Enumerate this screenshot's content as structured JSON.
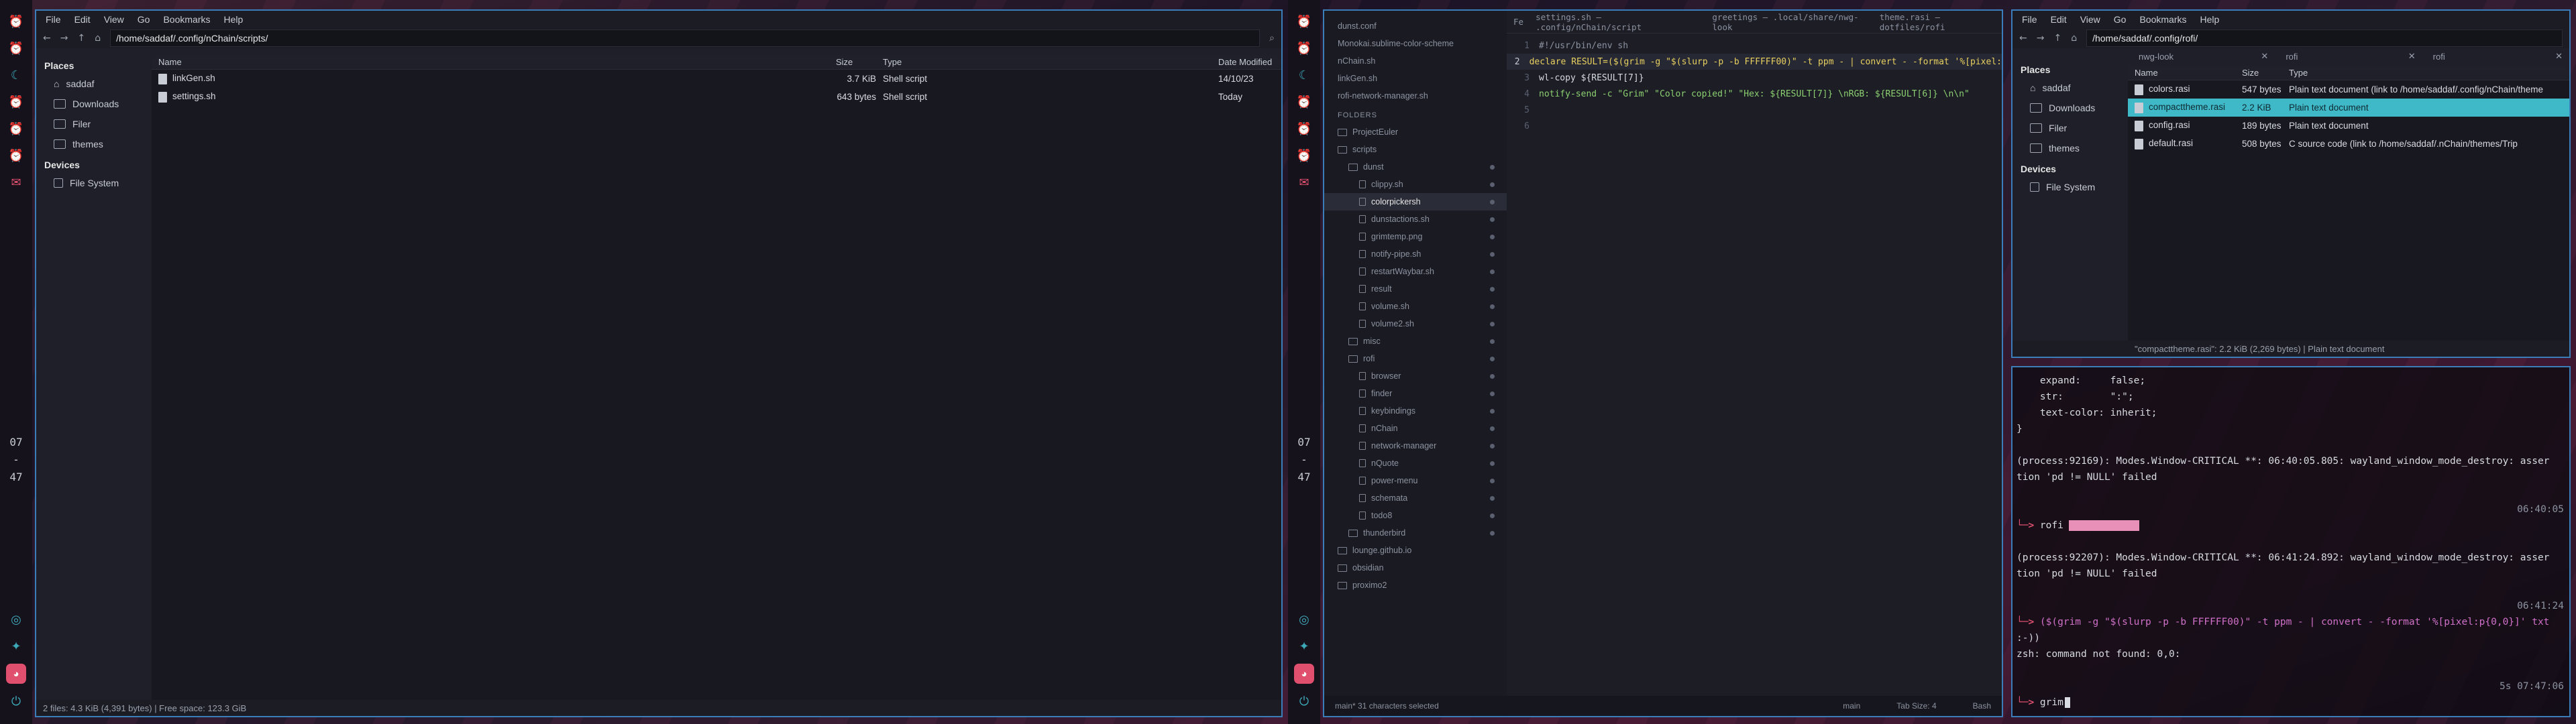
{
  "colors": {
    "accent": "#3fb8c8",
    "alert": "#e0506e",
    "border": "#3a7db8"
  },
  "bars": [
    {
      "icons": [
        "bell-icon",
        "bell-icon",
        "moon-icon",
        "bell-icon",
        "bell-icon",
        "bell-icon",
        "mail-icon"
      ],
      "clock": [
        "07",
        "-",
        "47"
      ],
      "bottom": [
        "network-icon",
        "share-icon",
        "discord-icon",
        "power-icon"
      ]
    }
  ],
  "left_fm": {
    "menu": [
      "File",
      "Edit",
      "View",
      "Go",
      "Bookmarks",
      "Help"
    ],
    "path": "/home/saddaf/.config/nChain/scripts/",
    "places_title": "Places",
    "places": [
      "saddaf",
      "Downloads",
      "Filer",
      "themes"
    ],
    "devices_title": "Devices",
    "devices": [
      "File System"
    ],
    "columns": [
      "Name",
      "Size",
      "Type",
      "Date Modified"
    ],
    "rows": [
      {
        "name": "linkGen.sh",
        "size": "3.7 KiB",
        "type": "Shell script",
        "date": "14/10/23"
      },
      {
        "name": "settings.sh",
        "size": "643 bytes",
        "type": "Shell script",
        "date": "Today"
      }
    ],
    "status": "2 files: 4.3 KiB (4,391 bytes) | Free space: 123.3 GiB"
  },
  "editor": {
    "open_files": [
      "dunst.conf",
      "Monokai.sublime-color-scheme",
      "nChain.sh",
      "linkGen.sh",
      "rofi-network-manager.sh"
    ],
    "tabs": [
      "Fe",
      "settings.sh — .config/nChain/script",
      "greetings — .local/share/nwg-look",
      "theme.rasi — dotfiles/rofi"
    ],
    "folders_label": "FOLDERS",
    "tree": [
      {
        "label": "ProjectEuler",
        "depth": 0,
        "folder": true
      },
      {
        "label": "scripts",
        "depth": 0,
        "folder": true
      },
      {
        "label": "dunst",
        "depth": 1,
        "folder": true
      },
      {
        "label": "clippy.sh",
        "depth": 2
      },
      {
        "label": "colorpickersh",
        "depth": 2,
        "active": true
      },
      {
        "label": "dunstactions.sh",
        "depth": 2
      },
      {
        "label": "grimtemp.png",
        "depth": 2
      },
      {
        "label": "notify-pipe.sh",
        "depth": 2
      },
      {
        "label": "restartWaybar.sh",
        "depth": 2
      },
      {
        "label": "result",
        "depth": 2
      },
      {
        "label": "volume.sh",
        "depth": 2
      },
      {
        "label": "volume2.sh",
        "depth": 2
      },
      {
        "label": "misc",
        "depth": 1,
        "folder": true
      },
      {
        "label": "rofi",
        "depth": 1,
        "folder": true
      },
      {
        "label": "browser",
        "depth": 2
      },
      {
        "label": "finder",
        "depth": 2
      },
      {
        "label": "keybindings",
        "depth": 2
      },
      {
        "label": "nChain",
        "depth": 2
      },
      {
        "label": "network-manager",
        "depth": 2
      },
      {
        "label": "nQuote",
        "depth": 2
      },
      {
        "label": "power-menu",
        "depth": 2
      },
      {
        "label": "schemata",
        "depth": 2
      },
      {
        "label": "todo8",
        "depth": 2
      },
      {
        "label": "thunderbird",
        "depth": 1,
        "folder": true
      },
      {
        "label": "lounge.github.io",
        "depth": 0,
        "folder": true
      },
      {
        "label": "obsidian",
        "depth": 0,
        "folder": true
      },
      {
        "label": "proximo2",
        "depth": 0,
        "folder": true
      }
    ],
    "code": [
      "#!/usr/bin/env sh",
      "declare RESULT=($(grim -g \"$(slurp -p -b FFFFFF00)\" -t ppm - | convert - -format '%[pixel:",
      "wl-copy ${RESULT[7]}",
      "notify-send -c \"Grim\" \"Color copied!\" \"Hex: ${RESULT[7]} \\nRGB: ${RESULT[6]} \\n\\n\"",
      "",
      ""
    ],
    "status_left": "main*   31 characters selected",
    "status_right": [
      "main",
      "Tab Size: 4",
      "Bash"
    ]
  },
  "right_fm": {
    "menu": [
      "File",
      "Edit",
      "View",
      "Go",
      "Bookmarks",
      "Help"
    ],
    "path": "/home/saddaf/.config/rofi/",
    "tabs": [
      "nwg-look",
      "rofi",
      "rofi"
    ],
    "places_title": "Places",
    "places": [
      "saddaf",
      "Downloads",
      "Filer",
      "themes"
    ],
    "devices_title": "Devices",
    "devices": [
      "File System"
    ],
    "columns": [
      "Name",
      "Size",
      "Type"
    ],
    "rows": [
      {
        "name": "colors.rasi",
        "size": "547 bytes",
        "type": "Plain text document (link to /home/saddaf/.config/nChain/theme"
      },
      {
        "name": "compacttheme.rasi",
        "size": "2.2 KiB",
        "type": "Plain text document",
        "selected": true
      },
      {
        "name": "config.rasi",
        "size": "189 bytes",
        "type": "Plain text document"
      },
      {
        "name": "default.rasi",
        "size": "508 bytes",
        "type": "C source code (link to /home/saddaf/.nChain/themes/Trip"
      }
    ],
    "status": "\"compacttheme.rasi\": 2.2 KiB (2,269 bytes) | Plain text document"
  },
  "terminal": {
    "lines": [
      "    expand:     false;",
      "    str:        \":\";",
      "    text-color: inherit;",
      "}",
      "",
      "(process:92169): Modes.Window-CRITICAL **: 06:40:05.805: wayland_window_mode_destroy: asser",
      "tion 'pd != NULL' failed",
      "",
      "06:40:05",
      "rofi",
      "",
      "(process:92207): Modes.Window-CRITICAL **: 06:41:24.892: wayland_window_mode_destroy: asser",
      "tion 'pd != NULL' failed",
      "",
      "06:41:24",
      "($(grim -g \"$(slurp -p -b FFFFFF00)\" -t ppm - | convert - -format '%[pixel:p{0,0}]' txt",
      ":-))",
      "zsh: command not found: 0,0:",
      "",
      "5s 07:47:06",
      "grim"
    ]
  }
}
